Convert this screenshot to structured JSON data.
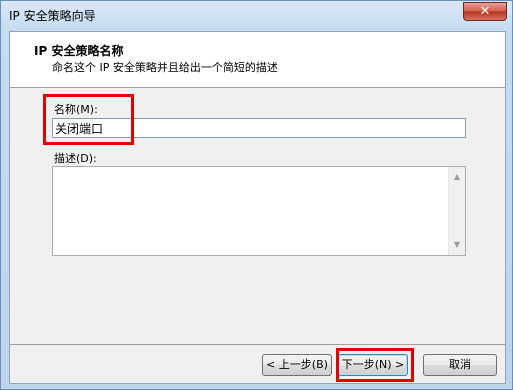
{
  "window": {
    "title": "IP 安全策略向导",
    "close_glyph": "✕"
  },
  "header": {
    "title": "IP 安全策略名称",
    "subtitle": "命名这个 IP 安全策略并且给出一个简短的描述"
  },
  "form": {
    "name_label": "名称(M):",
    "name_value": "关闭端口",
    "description_label": "描述(D):",
    "description_value": ""
  },
  "scrollbar": {
    "up_glyph": "▲",
    "down_glyph": "▼"
  },
  "buttons": {
    "back": "< 上一步(B)",
    "next": "下一步(N) >",
    "cancel": "取消"
  },
  "colors": {
    "highlight": "#e00000"
  }
}
